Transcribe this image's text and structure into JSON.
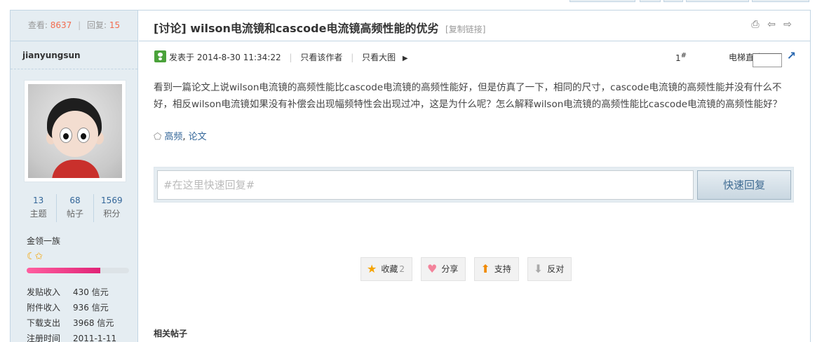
{
  "thread": {
    "views_label": "查看:",
    "views": "8637",
    "replies_label": "回复:",
    "replies": "15",
    "prefix": "[讨论]",
    "title": "wilson电流镜和cascode电流镜高频性能的优劣",
    "copy_link": "[复制链接]"
  },
  "author": {
    "username": "jianyungsun",
    "stats": [
      {
        "value": "13",
        "label": "主题"
      },
      {
        "value": "68",
        "label": "帖子"
      },
      {
        "value": "1569",
        "label": "积分"
      }
    ],
    "group": "金领一族",
    "rank_icons": "☾✩",
    "rank_progress_percent": 72,
    "info": [
      {
        "key": "发贴收入",
        "value": "430 信元"
      },
      {
        "key": "附件收入",
        "value": "936 信元"
      },
      {
        "key": "下载支出",
        "value": "3968 信元"
      },
      {
        "key": "注册时间",
        "value": "2011-1-11"
      }
    ]
  },
  "post": {
    "posted_at": "发表于 2014-8-30 11:34:22",
    "only_author": "只看该作者",
    "only_large_image": "只看大图",
    "floor_number": "1",
    "floor_mark": "#",
    "jump_label": "电梯直达",
    "content": "看到一篇论文上说wilson电流镜的高频性能比cascode电流镜的高频性能好，但是仿真了一下，相同的尺寸，cascode电流镜的高频性能并没有什么不好，相反wilson电流镜如果没有补偿会出现幅频特性会出现过冲，这是为什么呢？怎么解释wilson电流镜的高频性能比cascode电流镜的高频性能好？",
    "tags": [
      "高频",
      "论文"
    ],
    "tag_separator": ", "
  },
  "quick_reply": {
    "placeholder": "#在这里快速回复#",
    "button": "快速回复"
  },
  "actions": [
    {
      "label": "收藏",
      "count": "2",
      "icon": "star-icon"
    },
    {
      "label": "分享",
      "icon": "heart-icon"
    },
    {
      "label": "支持",
      "icon": "thumb-up-icon"
    },
    {
      "label": "反对",
      "icon": "thumb-down-icon"
    }
  ],
  "related": {
    "heading": "相关帖子"
  },
  "colors": {
    "accent_blue": "#336699",
    "sidebar_bg": "#e5edf2",
    "border": "#c2d5e3",
    "count_orange": "#f26c4f"
  }
}
